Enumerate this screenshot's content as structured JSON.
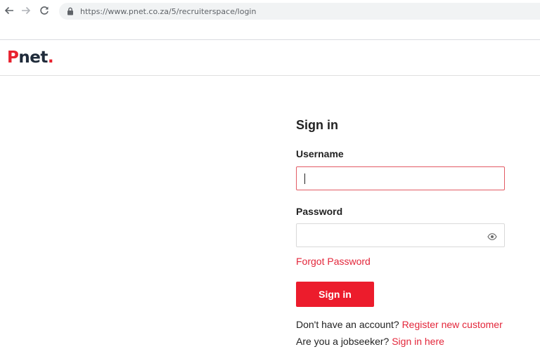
{
  "browser": {
    "url": "https://www.pnet.co.za/5/recruiterspace/login"
  },
  "site": {
    "logo_p": "P",
    "logo_rest": "net",
    "logo_dot": ".",
    "brand_color": "#e8222e"
  },
  "form": {
    "title": "Sign in",
    "username_label": "Username",
    "username_value": "",
    "password_label": "Password",
    "password_value": "",
    "forgot_password": "Forgot Password",
    "signin_button": "Sign in",
    "no_account_text": "Don't have an account?",
    "register_link": "Register new customer",
    "jobseeker_text": "Are you a jobseeker?",
    "jobseeker_link": "Sign in here"
  },
  "icons": {
    "back": "back-arrow-icon",
    "forward": "forward-arrow-icon",
    "reload": "reload-icon",
    "lock": "lock-icon",
    "eye": "eye-icon"
  }
}
